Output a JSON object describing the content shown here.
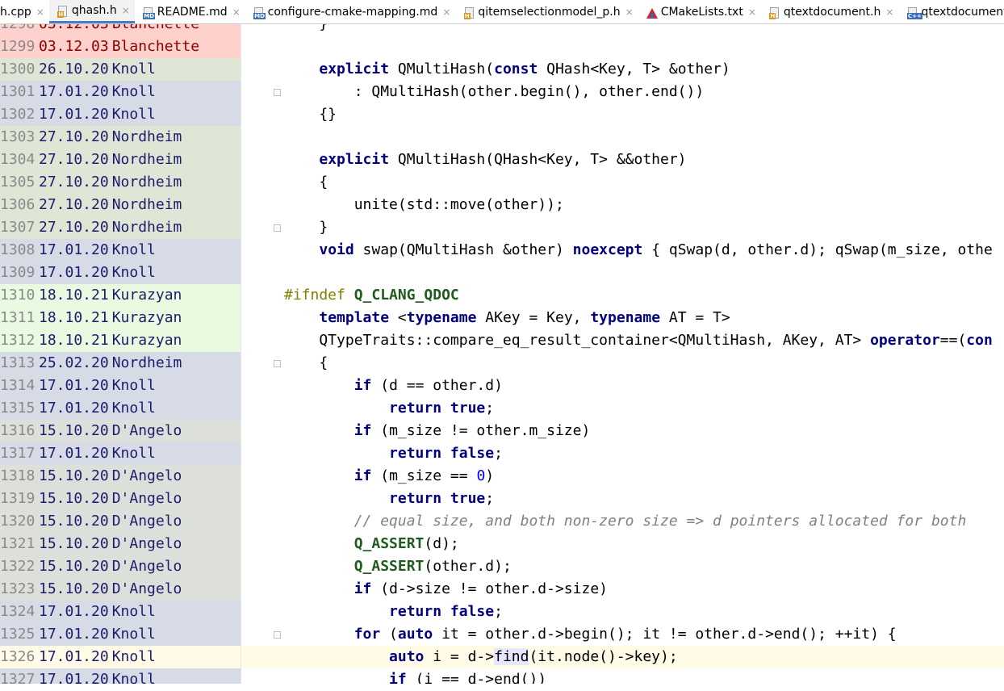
{
  "tabs": [
    {
      "label": "h.cpp",
      "icon": "cpp-file-icon",
      "active": false
    },
    {
      "label": "qhash.h",
      "icon": "header-file-icon",
      "active": true
    },
    {
      "label": "README.md",
      "icon": "markdown-file-icon",
      "active": false
    },
    {
      "label": "configure-cmake-mapping.md",
      "icon": "markdown-file-icon",
      "active": false
    },
    {
      "label": "qitemselectionmodel_p.h",
      "icon": "header-file-icon",
      "active": false
    },
    {
      "label": "CMakeLists.txt",
      "icon": "cmake-icon",
      "active": false
    },
    {
      "label": "qtextdocument.h",
      "icon": "header-file-icon",
      "active": false
    },
    {
      "label": "qtextdocument_p.cpp",
      "icon": "cpp-file-icon",
      "active": false
    }
  ],
  "tab_close_glyph": "×",
  "annotations": [
    {
      "line": "1298",
      "date": "03.12.03",
      "author": "Blanchette",
      "color": "#ffd1cd"
    },
    {
      "line": "1299",
      "date": "03.12.03",
      "author": "Blanchette",
      "color": "#ffd1cd"
    },
    {
      "line": "1300",
      "date": "26.10.20",
      "author": "Knoll",
      "color": "#e0e6d6"
    },
    {
      "line": "1301",
      "date": "17.01.20",
      "author": "Knoll",
      "color": "#d6dbe6"
    },
    {
      "line": "1302",
      "date": "17.01.20",
      "author": "Knoll",
      "color": "#d6dbe6"
    },
    {
      "line": "1303",
      "date": "27.10.20",
      "author": "Nordheim",
      "color": "#e0e6d6"
    },
    {
      "line": "1304",
      "date": "27.10.20",
      "author": "Nordheim",
      "color": "#e0e6d6"
    },
    {
      "line": "1305",
      "date": "27.10.20",
      "author": "Nordheim",
      "color": "#e0e6d6"
    },
    {
      "line": "1306",
      "date": "27.10.20",
      "author": "Nordheim",
      "color": "#e0e6d6"
    },
    {
      "line": "1307",
      "date": "27.10.20",
      "author": "Nordheim",
      "color": "#e0e6d6"
    },
    {
      "line": "1308",
      "date": "17.01.20",
      "author": "Knoll",
      "color": "#d6dbe6"
    },
    {
      "line": "1309",
      "date": "17.01.20",
      "author": "Knoll",
      "color": "#d6dbe6"
    },
    {
      "line": "1310",
      "date": "18.10.21",
      "author": "Kurazyan",
      "color": "#e8fae0"
    },
    {
      "line": "1311",
      "date": "18.10.21",
      "author": "Kurazyan",
      "color": "#e8fae0"
    },
    {
      "line": "1312",
      "date": "18.10.21",
      "author": "Kurazyan",
      "color": "#e8fae0"
    },
    {
      "line": "1313",
      "date": "25.02.20",
      "author": "Nordheim",
      "color": "#d6dbe6"
    },
    {
      "line": "1314",
      "date": "17.01.20",
      "author": "Knoll",
      "color": "#d6dbe6"
    },
    {
      "line": "1315",
      "date": "17.01.20",
      "author": "Knoll",
      "color": "#d6dbe6"
    },
    {
      "line": "1316",
      "date": "15.10.20",
      "author": "D'Angelo",
      "color": "#dde0da"
    },
    {
      "line": "1317",
      "date": "17.01.20",
      "author": "Knoll",
      "color": "#d6dbe6"
    },
    {
      "line": "1318",
      "date": "15.10.20",
      "author": "D'Angelo",
      "color": "#dde0da"
    },
    {
      "line": "1319",
      "date": "15.10.20",
      "author": "D'Angelo",
      "color": "#dde0da"
    },
    {
      "line": "1320",
      "date": "15.10.20",
      "author": "D'Angelo",
      "color": "#dde0da"
    },
    {
      "line": "1321",
      "date": "15.10.20",
      "author": "D'Angelo",
      "color": "#dde0da"
    },
    {
      "line": "1322",
      "date": "15.10.20",
      "author": "D'Angelo",
      "color": "#dde0da"
    },
    {
      "line": "1323",
      "date": "15.10.20",
      "author": "D'Angelo",
      "color": "#dde0da"
    },
    {
      "line": "1324",
      "date": "17.01.20",
      "author": "Knoll",
      "color": "#d6dbe6"
    },
    {
      "line": "1325",
      "date": "17.01.20",
      "author": "Knoll",
      "color": "#d6dbe6"
    },
    {
      "line": "1326",
      "date": "17.01.20",
      "author": "Knoll",
      "color": "#d6dbe6"
    },
    {
      "line": "1327",
      "date": "17.01.20",
      "author": "Knoll",
      "color": "#d6dbe6"
    }
  ],
  "code_lines": [
    [
      [
        "    }",
        ""
      ]
    ],
    [
      [
        "",
        ""
      ]
    ],
    [
      [
        "    ",
        ""
      ],
      [
        "explicit",
        "kw"
      ],
      [
        " QMultiHash(",
        ""
      ],
      [
        "const",
        "kw"
      ],
      [
        " QHash<Key, T> &other)",
        ""
      ]
    ],
    [
      [
        "        : QMultiHash(other.begin(), other.end())",
        ""
      ]
    ],
    [
      [
        "    {}",
        ""
      ]
    ],
    [
      [
        "",
        ""
      ]
    ],
    [
      [
        "    ",
        ""
      ],
      [
        "explicit",
        "kw"
      ],
      [
        " QMultiHash(QHash<Key, T> &&other)",
        ""
      ]
    ],
    [
      [
        "    {",
        ""
      ]
    ],
    [
      [
        "        unite(std::move(other));",
        ""
      ]
    ],
    [
      [
        "    }",
        ""
      ]
    ],
    [
      [
        "    ",
        ""
      ],
      [
        "void",
        "kw"
      ],
      [
        " swap(QMultiHash &other) ",
        ""
      ],
      [
        "noexcept",
        "kw"
      ],
      [
        " { qSwap(d, other.d); qSwap(m_size, othe",
        ""
      ]
    ],
    [
      [
        "",
        ""
      ]
    ],
    [
      [
        "#ifndef ",
        "pp"
      ],
      [
        "Q_CLANG_QDOC",
        "mac"
      ]
    ],
    [
      [
        "    ",
        ""
      ],
      [
        "template",
        "kw"
      ],
      [
        " <",
        ""
      ],
      [
        "typename",
        "kw"
      ],
      [
        " AKey = Key, ",
        ""
      ],
      [
        "typename",
        "kw"
      ],
      [
        " AT = T>",
        ""
      ]
    ],
    [
      [
        "    QTypeTraits::compare_eq_result_container<QMultiHash, AKey, AT> ",
        ""
      ],
      [
        "operator",
        "kw"
      ],
      [
        "==(",
        ""
      ],
      [
        "con",
        "kw"
      ]
    ],
    [
      [
        "    {",
        ""
      ]
    ],
    [
      [
        "        ",
        ""
      ],
      [
        "if",
        "kw"
      ],
      [
        " (d == other.d)",
        ""
      ]
    ],
    [
      [
        "            ",
        ""
      ],
      [
        "return",
        "kw"
      ],
      [
        " ",
        ""
      ],
      [
        "true",
        "kw"
      ],
      [
        ";",
        ""
      ]
    ],
    [
      [
        "        ",
        ""
      ],
      [
        "if",
        "kw"
      ],
      [
        " (m_size != other.m_size)",
        ""
      ]
    ],
    [
      [
        "            ",
        ""
      ],
      [
        "return",
        "kw"
      ],
      [
        " ",
        ""
      ],
      [
        "false",
        "kw"
      ],
      [
        ";",
        ""
      ]
    ],
    [
      [
        "        ",
        ""
      ],
      [
        "if",
        "kw"
      ],
      [
        " (m_size == ",
        ""
      ],
      [
        "0",
        "num"
      ],
      [
        ")",
        ""
      ]
    ],
    [
      [
        "            ",
        ""
      ],
      [
        "return",
        "kw"
      ],
      [
        " ",
        ""
      ],
      [
        "true",
        "kw"
      ],
      [
        ";",
        ""
      ]
    ],
    [
      [
        "        ",
        ""
      ],
      [
        "// equal size, and both non-zero size => d pointers allocated for both",
        "cmt"
      ]
    ],
    [
      [
        "        ",
        ""
      ],
      [
        "Q_ASSERT",
        "mac"
      ],
      [
        "(d);",
        ""
      ]
    ],
    [
      [
        "        ",
        ""
      ],
      [
        "Q_ASSERT",
        "mac"
      ],
      [
        "(other.d);",
        ""
      ]
    ],
    [
      [
        "        ",
        ""
      ],
      [
        "if",
        "kw"
      ],
      [
        " (d->size != other.d->size)",
        ""
      ]
    ],
    [
      [
        "            ",
        ""
      ],
      [
        "return",
        "kw"
      ],
      [
        " ",
        ""
      ],
      [
        "false",
        "kw"
      ],
      [
        ";",
        ""
      ]
    ],
    [
      [
        "        ",
        ""
      ],
      [
        "for",
        "kw"
      ],
      [
        " (",
        ""
      ],
      [
        "auto",
        "kw"
      ],
      [
        " it = other.d->begin(); it != other.d->end(); ++it) {",
        ""
      ]
    ],
    [
      [
        "            ",
        ""
      ],
      [
        "auto",
        "kw"
      ],
      [
        " i = d->",
        ""
      ],
      [
        "find",
        "findhl"
      ],
      [
        "(it.node()->key);",
        ""
      ]
    ],
    [
      [
        "            ",
        ""
      ],
      [
        "if",
        "kw"
      ],
      [
        " (i == d->end())",
        ""
      ]
    ]
  ],
  "current_line": "1326",
  "fold_markers": [
    3,
    9,
    15,
    27
  ],
  "colors": {
    "keyword": "#000080",
    "macro": "#1f5a1f",
    "preprocessor": "#808000",
    "number": "#0000ff",
    "comment": "#808080",
    "current_line_bg": "#fffbe6",
    "active_tab_underline": "#4d7cc7"
  }
}
